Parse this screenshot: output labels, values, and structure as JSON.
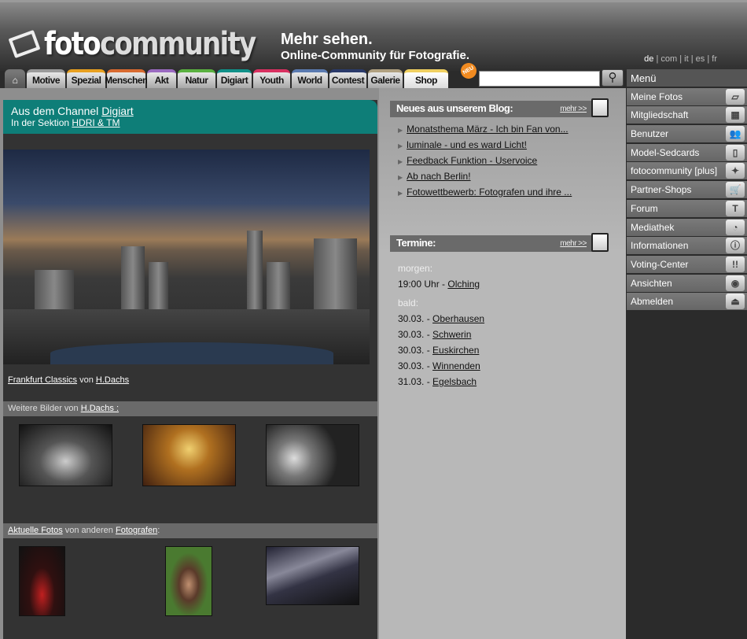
{
  "header": {
    "logo_bold": "foto",
    "logo_rest": "community",
    "slogan1": "Mehr sehen.",
    "slogan2": "Online-Community für Fotografie.",
    "languages": [
      "de",
      "com",
      "it",
      "es",
      "fr"
    ]
  },
  "tabs": [
    {
      "label": "Motive",
      "color": "#9a9a9a"
    },
    {
      "label": "Spezial",
      "color": "#e8a020"
    },
    {
      "label": "Menschen",
      "color": "#d86a30"
    },
    {
      "label": "Akt",
      "color": "#9a6ac0"
    },
    {
      "label": "Natur",
      "color": "#5ab040"
    },
    {
      "label": "Digiart",
      "color": "#109088"
    },
    {
      "label": "Youth",
      "color": "#d83060"
    },
    {
      "label": "World",
      "color": "#5a7ab0"
    },
    {
      "label": "Contest",
      "color": "#2a3a6a"
    },
    {
      "label": "Galerie",
      "color": "#b0a080"
    },
    {
      "label": "Shop",
      "color": "#f0d060",
      "badge": "NEU"
    }
  ],
  "search": {
    "placeholder": "",
    "value": ""
  },
  "channel": {
    "prefix": "Aus dem Channel ",
    "channel": "Digiart",
    "section_prefix": "In der Sektion ",
    "section": "HDRI & TM"
  },
  "photo": {
    "title": "Frankfurt Classics",
    "by": " von ",
    "author": "H.Dachs"
  },
  "more_by": {
    "prefix": "Weitere Bilder von ",
    "author": "H.Dachs :"
  },
  "current": {
    "link1": "Aktuelle Fotos",
    "mid": " von anderen ",
    "link2": "Fotografen",
    "suffix": ":"
  },
  "blog": {
    "title": "Neues aus unserem Blog:",
    "more": "mehr >>",
    "items": [
      "Monatsthema März - Ich bin Fan von...",
      "luminale - und es ward Licht! ",
      "Feedback Funktion - Uservoice",
      "Ab nach Berlin!",
      "Fotowettbewerb: Fotografen und ihre ..."
    ]
  },
  "termine": {
    "title": "Termine:",
    "more": "mehr >>",
    "tomorrow_label": "morgen:",
    "tomorrow": {
      "time": "19:00 Uhr - ",
      "place": "Olching"
    },
    "soon_label": "bald:",
    "soon": [
      {
        "date": "30.03. - ",
        "place": "Oberhausen"
      },
      {
        "date": "30.03. - ",
        "place": "Schwerin"
      },
      {
        "date": "30.03. - ",
        "place": "Euskirchen"
      },
      {
        "date": "30.03. - ",
        "place": "Winnenden"
      },
      {
        "date": "31.03. - ",
        "place": "Egelsbach"
      }
    ]
  },
  "menu": {
    "title": "Menü",
    "items": [
      {
        "label": "Meine Fotos",
        "icon": "photos-icon"
      },
      {
        "label": "Mitgliedschaft",
        "icon": "membership-icon"
      },
      {
        "label": "Benutzer",
        "icon": "users-icon"
      },
      {
        "label": "Model-Sedcards",
        "icon": "sedcard-icon"
      },
      {
        "label": "fotocommunity [plus]",
        "icon": "plus-new-icon"
      },
      {
        "label": "Partner-Shops",
        "icon": "cart-icon"
      },
      {
        "label": "Forum",
        "icon": "forum-icon"
      },
      {
        "label": "Mediathek",
        "icon": "rss-icon"
      },
      {
        "label": "Informationen",
        "icon": "info-icon"
      },
      {
        "label": "Voting-Center",
        "icon": "voting-icon"
      },
      {
        "label": "Ansichten",
        "icon": "eye-icon"
      },
      {
        "label": "Abmelden",
        "icon": "eject-icon"
      }
    ]
  }
}
